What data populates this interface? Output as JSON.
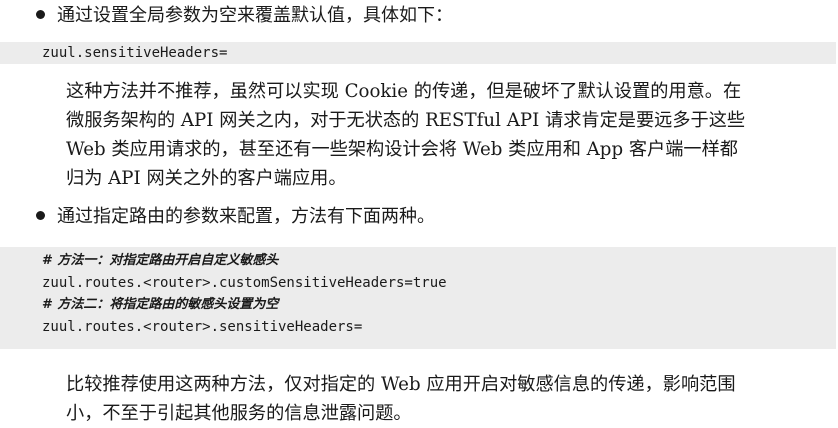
{
  "bullet1": {
    "text": "通过设置全局参数为空来覆盖默认值，具体如下："
  },
  "code1": {
    "lines": [
      "zuul.sensitiveHeaders="
    ]
  },
  "para1": {
    "lines": [
      "这种方法并不推荐，虽然可以实现 Cookie 的传递，但是破坏了默认设置的用意。在",
      "微服务架构的 API 网关之内，对于无状态的 RESTful API 请求肯定是要远多于这些",
      "Web 类应用请求的，甚至还有一些架构设计会将 Web 类应用和 App 客户端一样都",
      "归为 API 网关之外的客户端应用。"
    ]
  },
  "bullet2": {
    "text": "通过指定路由的参数来配置，方法有下面两种。"
  },
  "code2": {
    "comment1": "# 方法一：对指定路由开启自定义敏感头",
    "line1": "zuul.routes.<router>.customSensitiveHeaders=true",
    "comment2": "# 方法二：将指定路由的敏感头设置为空",
    "line2": "zuul.routes.<router>.sensitiveHeaders="
  },
  "para2": {
    "lines": [
      "比较推荐使用这两种方法，仅对指定的 Web 应用开启对敏感信息的传递，影响范围",
      "小，不至于引起其他服务的信息泄露问题。"
    ]
  }
}
